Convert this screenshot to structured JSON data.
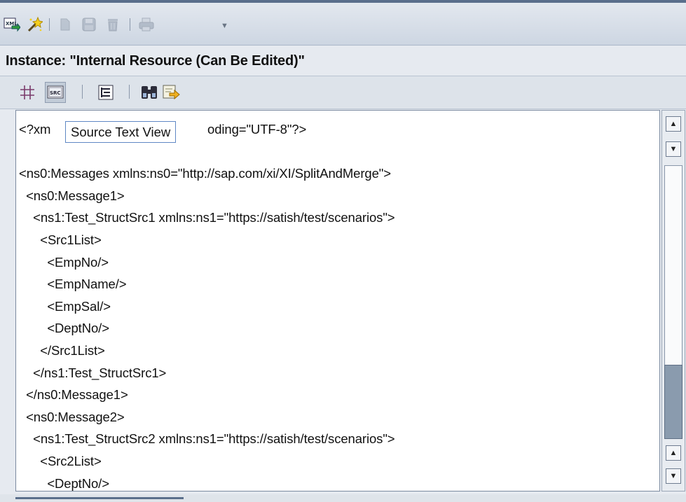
{
  "window": {
    "instance_title": "Instance: \"Internal Resource (Can Be Edited)\""
  },
  "toolbar1": {
    "buttons": [
      {
        "icon": "xml-import-icon"
      },
      {
        "icon": "wizard-icon"
      },
      {
        "icon": "new-icon"
      },
      {
        "icon": "save-icon"
      },
      {
        "icon": "delete-icon"
      },
      {
        "icon": "print-icon"
      }
    ]
  },
  "toolbar2": {
    "buttons": [
      {
        "icon": "grid-view-icon"
      },
      {
        "icon": "source-view-icon",
        "label": "SRC"
      },
      {
        "icon": "tree-view-icon"
      },
      {
        "icon": "find-icon"
      },
      {
        "icon": "export-icon"
      }
    ]
  },
  "tooltip": {
    "text": "Source Text View"
  },
  "editor": {
    "lines": [
      "<?xm",
      "",
      "<ns0:Messages xmlns:ns0=\"http://sap.com/xi/XI/SplitAndMerge\">",
      "  <ns0:Message1>",
      "    <ns1:Test_StructSrc1 xmlns:ns1=\"https://satish/test/scenarios\">",
      "      <Src1List>",
      "        <EmpNo/>",
      "        <EmpName/>",
      "        <EmpSal/>",
      "        <DeptNo/>",
      "      </Src1List>",
      "    </ns1:Test_StructSrc1>",
      "  </ns0:Message1>",
      "  <ns0:Message2>",
      "    <ns1:Test_StructSrc2 xmlns:ns1=\"https://satish/test/scenarios\">",
      "      <Src2List>",
      "        <DeptNo/>"
    ],
    "line1_tail": "oding=\"UTF-8\"?>"
  },
  "scrollbar": {
    "position_fraction": 0.75,
    "thumb_fraction": 0.27
  },
  "colors": {
    "accent": "#5a6f8c",
    "tooltip_border": "#5f88c4",
    "thumb": "#8a9bae"
  }
}
